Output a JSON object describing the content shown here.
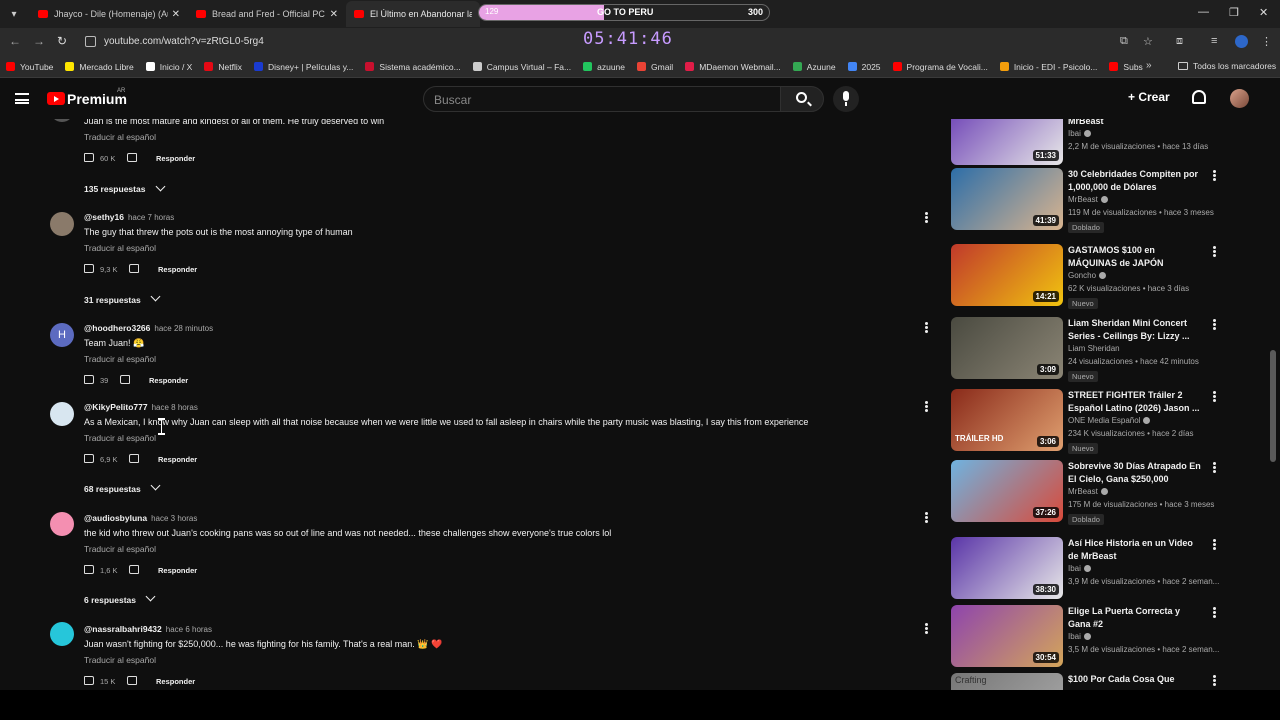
{
  "browser": {
    "tabs": [
      {
        "title": "Jhayco - Dile (Homenaje) (Audi",
        "active": false
      },
      {
        "title": "Bread and Fred - Official PC La",
        "active": false
      },
      {
        "title": "El Último en Abandonar la Tier",
        "active": true
      }
    ],
    "overlay": {
      "left": "129",
      "middle": "GO TO PERU",
      "right": "300",
      "progress_percent": 43
    },
    "url": "youtube.com/watch?v=zRtGL0-5rg4",
    "clock": "05:41:46",
    "bookmarks": [
      {
        "label": "YouTube",
        "color": "#ff0000"
      },
      {
        "label": "Mercado Libre",
        "color": "#ffe600"
      },
      {
        "label": "Inicio / X",
        "color": "#ffffff"
      },
      {
        "label": "Netflix",
        "color": "#e50914"
      },
      {
        "label": "Disney+ | Películas y...",
        "color": "#1a3bd1"
      },
      {
        "label": "Sistema académico...",
        "color": "#c8102e"
      },
      {
        "label": "Campus Virtual – Fa...",
        "color": "#cccccc"
      },
      {
        "label": "azuune",
        "color": "#22c55e"
      },
      {
        "label": "Gmail",
        "color": "#ea4335"
      },
      {
        "label": "MDaemon Webmail...",
        "color": "#e11d48"
      },
      {
        "label": "Azuune",
        "color": "#34a853"
      },
      {
        "label": "2025",
        "color": "#4285f4"
      },
      {
        "label": "Programa de Vocali...",
        "color": "#ff0000"
      },
      {
        "label": "Inicio - EDI - Psicolo...",
        "color": "#f59e0b"
      },
      {
        "label": "Subs",
        "color": "#ff0000"
      }
    ],
    "bookmarks_all": "Todos los marcadores"
  },
  "youtube": {
    "brand": "Premium",
    "country": "AR",
    "search_placeholder": "Buscar",
    "create_label": "Crear"
  },
  "comments": {
    "translate_label": "Traducir al español",
    "reply_label": "Responder",
    "items": [
      {
        "author": "",
        "time": "",
        "text": "Juan is the most mature and kindest of all of them. He truly deserved to win",
        "likes": "60 K",
        "replies": "135 respuestas",
        "avatar_color": "#555555"
      },
      {
        "author": "@sethy16",
        "time": "hace 7 horas",
        "text": "The guy that threw the pots out is the most annoying type of human",
        "likes": "9,3 K",
        "replies": "31 respuestas",
        "avatar_color": "#8a7a6a"
      },
      {
        "author": "@hoodhero3266",
        "time": "hace 28 minutos",
        "text": "Team Juan! 😤",
        "likes": "39",
        "replies": "",
        "avatar_color": "#5c6bc0",
        "avatar_letter": "H"
      },
      {
        "author": "@KikyPelito777",
        "time": "hace 8 horas",
        "text": "As a Mexican, I know why Juan can sleep with all that noise because when we were little we used to fall asleep in chairs while the party music was blasting, I say this from experience",
        "likes": "6,9 K",
        "replies": "68 respuestas",
        "avatar_color": "#d8e6f0"
      },
      {
        "author": "@audiosbyluna",
        "time": "hace 3 horas",
        "text": "the kid who threw out Juan's cooking pans was so out of line and was not needed... these challenges show everyone's true colors lol",
        "likes": "1,6 K",
        "replies": "6 respuestas",
        "avatar_color": "#f48fb1"
      },
      {
        "author": "@nassralbahri9432",
        "time": "hace 6 horas",
        "text": "Juan wasn't fighting for $250,000... he was fighting for his family. That's a real man. 👑 ❤️",
        "likes": "15 K",
        "replies": "",
        "avatar_color": "#26c6da"
      }
    ]
  },
  "recommendations": [
    {
      "title": "MrBeast",
      "channel": "Ibai",
      "verified": true,
      "meta": "2,2 M de visualizaciones • hace 13 días",
      "badge": "",
      "duration": "51:33",
      "thumb": [
        "#6b3fb5",
        "#e8e8e8"
      ]
    },
    {
      "title": "30 Celebridades Compiten por 1,000,000 de Dólares",
      "channel": "MrBeast",
      "verified": true,
      "meta": "119 M de visualizaciones • hace 3 meses",
      "badge": "Doblado",
      "duration": "41:39",
      "thumb": [
        "#2d6ea8",
        "#d9b48f"
      ]
    },
    {
      "title": "GASTAMOS $100 en MÁQUINAS de JAPÓN",
      "channel": "Goncho",
      "verified": true,
      "meta": "62 K visualizaciones • hace 3 días",
      "badge": "Nuevo",
      "duration": "14:21",
      "thumb": [
        "#c0392b",
        "#f1c40f"
      ]
    },
    {
      "title": "Liam Sheridan Mini Concert Series - Ceilings By: Lizzy ...",
      "channel": "Liam Sheridan",
      "verified": false,
      "meta": "24 visualizaciones • hace 42 minutos",
      "badge": "Nuevo",
      "duration": "3:09",
      "thumb": [
        "#4a4a40",
        "#8b8575"
      ]
    },
    {
      "title": "STREET FIGHTER Tráiler 2 Español Latino (2026) Jason ...",
      "channel": "ONE Media Español",
      "verified": true,
      "meta": "234 K visualizaciones • hace 2 días",
      "badge": "Nuevo",
      "duration": "3:06",
      "thumb": [
        "#8a2a1a",
        "#e0a070"
      ],
      "overlay": "TRÁILER HD"
    },
    {
      "title": "Sobrevive 30 Días Atrapado En El Cielo, Gana $250,000",
      "channel": "MrBeast",
      "verified": true,
      "meta": "175 M de visualizaciones • hace 3 meses",
      "badge": "Doblado",
      "duration": "37:26",
      "thumb": [
        "#6fb3e0",
        "#d94a3a"
      ]
    },
    {
      "title": "Así Hice Historia en un Video de MrBeast",
      "channel": "Ibai",
      "verified": true,
      "meta": "3,9 M de visualizaciones • hace 2 seman...",
      "badge": "",
      "duration": "38:30",
      "thumb": [
        "#5a35a8",
        "#e8e8e8"
      ]
    },
    {
      "title": "Elige La Puerta Correcta y Gana #2",
      "channel": "Ibai",
      "verified": true,
      "meta": "3,5 M de visualizaciones • hace 2 seman...",
      "badge": "",
      "duration": "30:54",
      "thumb": [
        "#8e44ad",
        "#d4a55a"
      ]
    },
    {
      "title": "$100 Por Cada Cosa Que",
      "channel": "",
      "verified": false,
      "meta": "",
      "badge": "",
      "duration": "",
      "thumb": [
        "#777777",
        "#aaaaaa"
      ],
      "overlay": "Crafting"
    }
  ]
}
